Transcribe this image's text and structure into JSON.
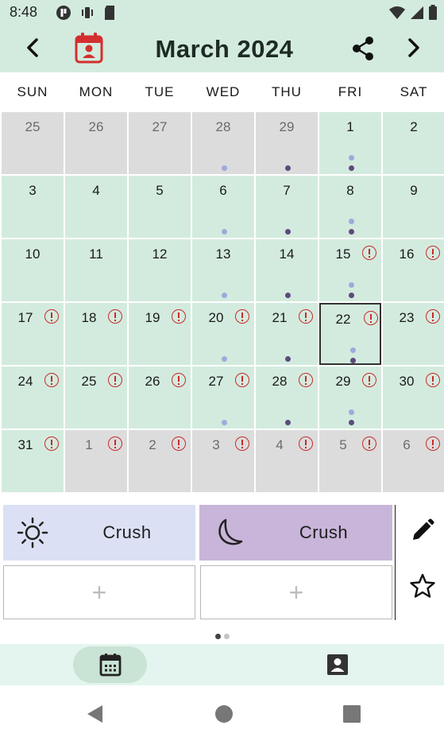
{
  "status_bar": {
    "time": "8:48"
  },
  "header": {
    "month_title": "March 2024"
  },
  "weekdays": [
    "SUN",
    "MON",
    "TUE",
    "WED",
    "THU",
    "FRI",
    "SAT"
  ],
  "calendar": {
    "selected_day": 22,
    "weeks": [
      [
        {
          "d": "25",
          "cur": false,
          "alert": false,
          "light": false,
          "dark": false
        },
        {
          "d": "26",
          "cur": false,
          "alert": false,
          "light": false,
          "dark": false
        },
        {
          "d": "27",
          "cur": false,
          "alert": false,
          "light": false,
          "dark": false
        },
        {
          "d": "28",
          "cur": false,
          "alert": false,
          "light": true,
          "dark": false
        },
        {
          "d": "29",
          "cur": false,
          "alert": false,
          "light": false,
          "dark": true
        },
        {
          "d": "1",
          "cur": true,
          "alert": false,
          "light": true,
          "dark": true
        },
        {
          "d": "2",
          "cur": true,
          "alert": false,
          "light": false,
          "dark": false
        }
      ],
      [
        {
          "d": "3",
          "cur": true,
          "alert": false,
          "light": false,
          "dark": false
        },
        {
          "d": "4",
          "cur": true,
          "alert": false,
          "light": false,
          "dark": false
        },
        {
          "d": "5",
          "cur": true,
          "alert": false,
          "light": false,
          "dark": false
        },
        {
          "d": "6",
          "cur": true,
          "alert": false,
          "light": true,
          "dark": false
        },
        {
          "d": "7",
          "cur": true,
          "alert": false,
          "light": false,
          "dark": true
        },
        {
          "d": "8",
          "cur": true,
          "alert": false,
          "light": true,
          "dark": true
        },
        {
          "d": "9",
          "cur": true,
          "alert": false,
          "light": false,
          "dark": false
        }
      ],
      [
        {
          "d": "10",
          "cur": true,
          "alert": false,
          "light": false,
          "dark": false
        },
        {
          "d": "11",
          "cur": true,
          "alert": false,
          "light": false,
          "dark": false
        },
        {
          "d": "12",
          "cur": true,
          "alert": false,
          "light": false,
          "dark": false
        },
        {
          "d": "13",
          "cur": true,
          "alert": false,
          "light": true,
          "dark": false
        },
        {
          "d": "14",
          "cur": true,
          "alert": false,
          "light": false,
          "dark": true
        },
        {
          "d": "15",
          "cur": true,
          "alert": true,
          "light": true,
          "dark": true
        },
        {
          "d": "16",
          "cur": true,
          "alert": true,
          "light": false,
          "dark": false
        }
      ],
      [
        {
          "d": "17",
          "cur": true,
          "alert": true,
          "light": false,
          "dark": false
        },
        {
          "d": "18",
          "cur": true,
          "alert": true,
          "light": false,
          "dark": false
        },
        {
          "d": "19",
          "cur": true,
          "alert": true,
          "light": false,
          "dark": false
        },
        {
          "d": "20",
          "cur": true,
          "alert": true,
          "light": true,
          "dark": false
        },
        {
          "d": "21",
          "cur": true,
          "alert": true,
          "light": false,
          "dark": true
        },
        {
          "d": "22",
          "cur": true,
          "alert": true,
          "light": true,
          "dark": true
        },
        {
          "d": "23",
          "cur": true,
          "alert": true,
          "light": false,
          "dark": false
        }
      ],
      [
        {
          "d": "24",
          "cur": true,
          "alert": true,
          "light": false,
          "dark": false
        },
        {
          "d": "25",
          "cur": true,
          "alert": true,
          "light": false,
          "dark": false
        },
        {
          "d": "26",
          "cur": true,
          "alert": true,
          "light": false,
          "dark": false
        },
        {
          "d": "27",
          "cur": true,
          "alert": true,
          "light": true,
          "dark": false
        },
        {
          "d": "28",
          "cur": true,
          "alert": true,
          "light": false,
          "dark": true
        },
        {
          "d": "29",
          "cur": true,
          "alert": true,
          "light": true,
          "dark": true
        },
        {
          "d": "30",
          "cur": true,
          "alert": true,
          "light": false,
          "dark": false
        }
      ],
      [
        {
          "d": "31",
          "cur": true,
          "alert": true,
          "light": false,
          "dark": false
        },
        {
          "d": "1",
          "cur": false,
          "alert": true,
          "light": false,
          "dark": false
        },
        {
          "d": "2",
          "cur": false,
          "alert": true,
          "light": false,
          "dark": false
        },
        {
          "d": "3",
          "cur": false,
          "alert": true,
          "light": false,
          "dark": false
        },
        {
          "d": "4",
          "cur": false,
          "alert": true,
          "light": false,
          "dark": false
        },
        {
          "d": "5",
          "cur": false,
          "alert": true,
          "light": false,
          "dark": false
        },
        {
          "d": "6",
          "cur": false,
          "alert": true,
          "light": false,
          "dark": false
        }
      ]
    ]
  },
  "routine": {
    "day_card_label": "Crush",
    "night_card_label": "Crush",
    "add_symbol": "+"
  },
  "colors": {
    "mint": "#d3ebde",
    "other_month": "#dcdcdc",
    "day_card": "#dbe0f4",
    "night_card": "#c8b5d9",
    "alert": "#c92a2a",
    "dot_light": "#9fa9dc",
    "dot_dark": "#5c4a7e",
    "calendar_icon": "#d32f2f"
  },
  "icons": {
    "prev": "chevron-left-icon",
    "next": "chevron-right-icon",
    "calendar": "calendar-contact-icon",
    "share": "share-icon",
    "day": "sun-icon",
    "night": "moon-icon",
    "edit": "pencil-icon",
    "favorite": "star-outline-icon"
  }
}
